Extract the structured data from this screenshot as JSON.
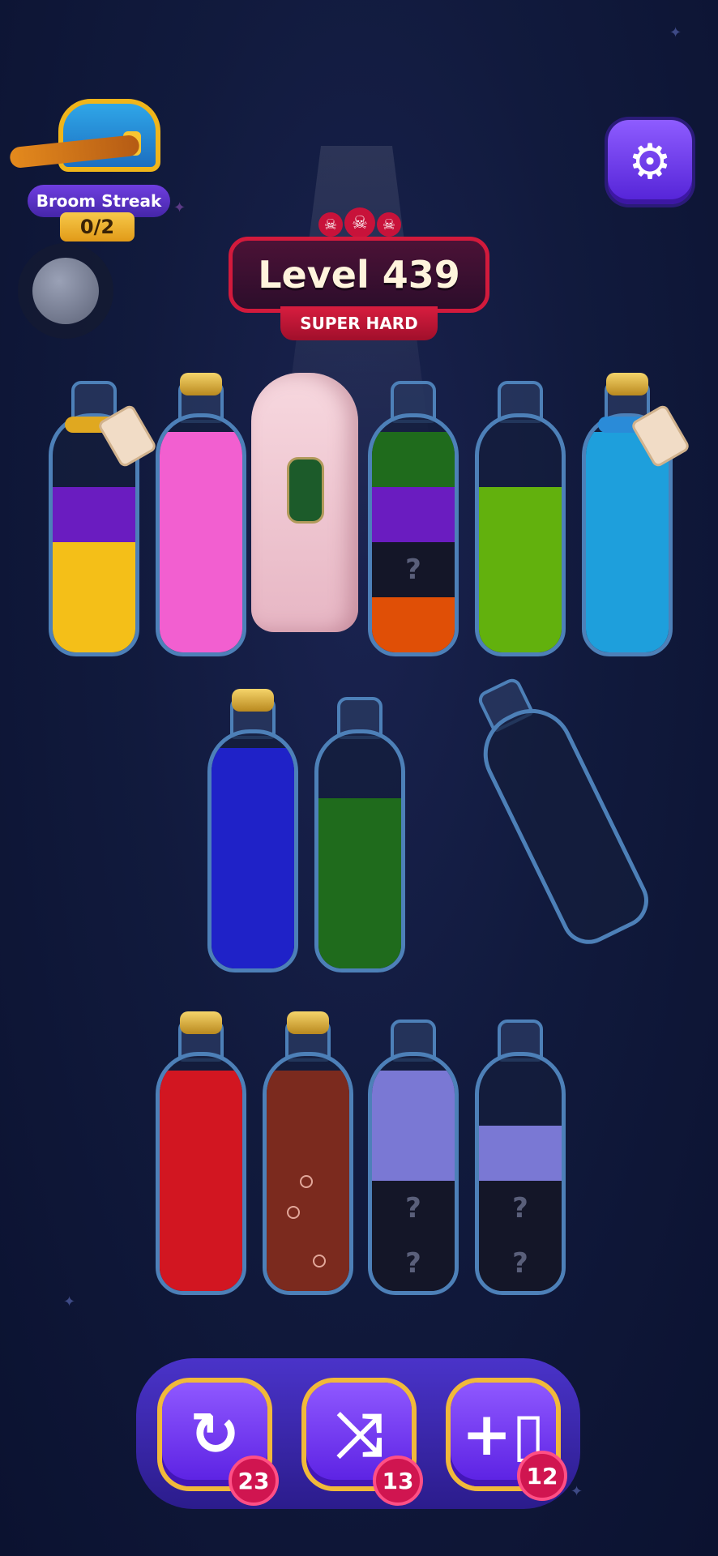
{
  "streak": {
    "title": "Broom Streak",
    "count": "0/2"
  },
  "level": {
    "title": "Level 439",
    "difficulty": "SUPER HARD"
  },
  "hidden_mark": "?",
  "icons": {
    "settings": "gear-icon",
    "undo": "undo-icon",
    "shuffle": "shuffle-icon",
    "add_bottle": "add-bottle-icon"
  },
  "colors": {
    "yellow": "#f4bf18",
    "purple": "#6a1cc0",
    "pink": "#f25fd0",
    "green": "#1f6b1c",
    "orange": "#e04f06",
    "lime": "#62b10d",
    "cyan": "#1e9fdc",
    "blue": "#1f22c8",
    "red": "#d21621",
    "brown": "#7b2a1e",
    "lavender": "#7a78d4",
    "dark": "#141628"
  },
  "bottles": [
    {
      "id": "b1",
      "locked": "rope-gold",
      "layers": [
        "yellow",
        "yellow",
        "purple"
      ]
    },
    {
      "id": "b2",
      "cork": true,
      "layers": [
        "pink",
        "pink",
        "pink",
        "pink"
      ]
    },
    {
      "id": "b3",
      "covered": true
    },
    {
      "id": "b4",
      "layers": [
        "orange",
        "hidden",
        "purple",
        "green"
      ]
    },
    {
      "id": "b5",
      "layers": [
        "lime",
        "lime",
        "lime"
      ]
    },
    {
      "id": "b6",
      "locked": "rope-blue",
      "cork": true,
      "layers": [
        "cyan",
        "cyan",
        "cyan",
        "cyan"
      ]
    },
    {
      "id": "b7",
      "cork": true,
      "layers": [
        "blue",
        "blue",
        "blue",
        "blue"
      ]
    },
    {
      "id": "b8",
      "layers": [
        "green",
        "green",
        "green"
      ]
    },
    {
      "id": "b9",
      "layers": []
    },
    {
      "id": "b10",
      "cork": true,
      "layers": [
        "red",
        "red",
        "red",
        "red"
      ]
    },
    {
      "id": "b11",
      "cork": true,
      "layers": [
        "brown",
        "brown",
        "brown",
        "brown"
      ]
    },
    {
      "id": "b12",
      "layers": [
        "hidden",
        "hidden",
        "lavender",
        "lavender"
      ]
    },
    {
      "id": "b13",
      "layers": [
        "hidden",
        "hidden",
        "lavender"
      ]
    }
  ],
  "boosters": [
    {
      "name": "undo",
      "count": "23"
    },
    {
      "name": "shuffle",
      "count": "13"
    },
    {
      "name": "add-bottle",
      "count": "12"
    }
  ]
}
